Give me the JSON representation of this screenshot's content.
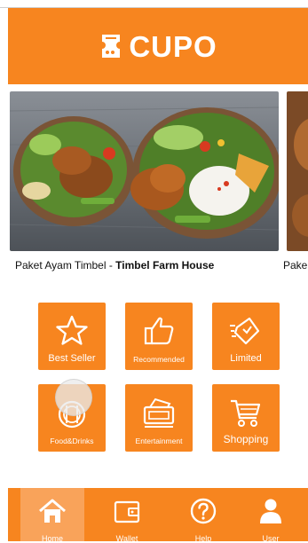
{
  "app": {
    "logo_text": "CUPO",
    "brand_color": "#f7851f"
  },
  "carousel": {
    "slides": [
      {
        "caption_prefix": "Paket Ayam Timbel - ",
        "caption_bold": "Timbel Farm House"
      },
      {
        "caption_prefix": "Pake"
      }
    ]
  },
  "categories": [
    {
      "label": "Best Seller",
      "icon": "star-icon"
    },
    {
      "label": "Recommended",
      "icon": "thumbs-up-icon"
    },
    {
      "label": "Limited",
      "icon": "limited-tag-icon"
    },
    {
      "label": "Food&Drinks",
      "icon": "food-drinks-icon"
    },
    {
      "label": "Entertainment",
      "icon": "ticket-icon"
    },
    {
      "label": "Shopping",
      "icon": "shopping-cart-icon"
    }
  ],
  "bottom_nav": {
    "items": [
      {
        "label": "Home",
        "icon": "home-icon",
        "active": true
      },
      {
        "label": "Wallet",
        "icon": "wallet-icon",
        "active": false
      },
      {
        "label": "Help",
        "icon": "help-icon",
        "active": false
      },
      {
        "label": "User",
        "icon": "user-icon",
        "active": false
      }
    ]
  }
}
